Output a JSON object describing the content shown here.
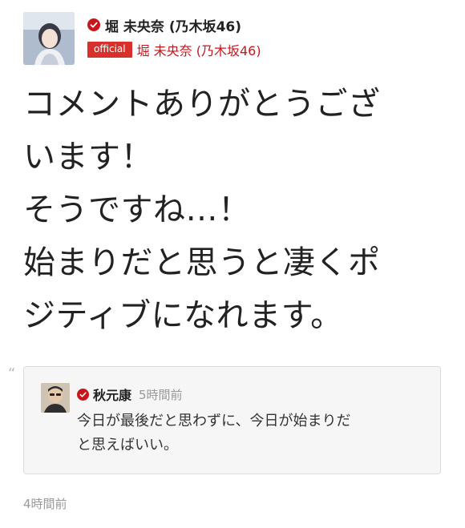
{
  "post": {
    "author": {
      "name": "堀 未央奈 (乃木坂46)",
      "official_badge": "official",
      "official_name": "堀 未央奈 (乃木坂46)",
      "avatar_icon": "profile-photo",
      "verified_icon": "verified-check-icon",
      "verified_color": "#c8161d"
    },
    "body": "コメントありがとうござ\nいます！\nそうですね…！\n始まりだと思うと凄くポ\nジティブになれます。",
    "quote_mark": "“",
    "quoted": {
      "author_name": "秋元康",
      "time": "5時間前",
      "text": "今日が最後だと思わずに、今日が始まりだ\nと思えばいい。",
      "avatar_icon": "profile-photo"
    },
    "timestamp": "4時間前"
  }
}
